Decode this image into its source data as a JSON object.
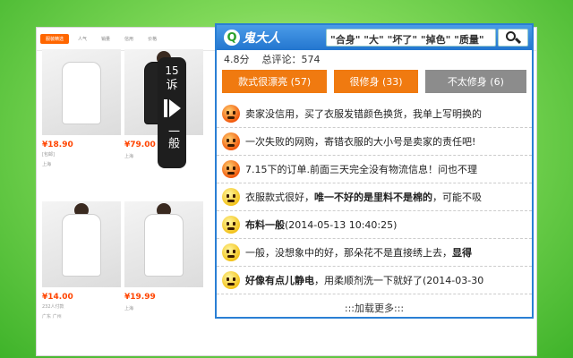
{
  "shop": {
    "nav": [
      "服装精选",
      "人气",
      "销量",
      "信用",
      "价格"
    ],
    "cards": [
      {
        "price": "¥18.90",
        "meta": "[包邮]",
        "loc": "上海"
      },
      {
        "price": "¥79.00",
        "meta": "",
        "loc": "上海"
      },
      {
        "price": "¥14.00",
        "meta": "232人付款",
        "loc": "广东 广州"
      },
      {
        "price": "¥19.99",
        "meta": "",
        "loc": "上海"
      }
    ]
  },
  "side_tab": {
    "count": "15",
    "label_top": "诉",
    "label_bottom": "一般"
  },
  "popup": {
    "logo_letter": "Q",
    "logo_text": "鬼大人",
    "search_value": "\"合身\" \"大\" \"坏了\" \"掉色\" \"质量\"",
    "score": "4.8分",
    "total_reviews": "总评论：574",
    "tags": [
      {
        "label": "款式很漂亮 (57)",
        "color": "#f07a10"
      },
      {
        "label": "很修身 (33)",
        "color": "#f07a10"
      },
      {
        "label": "不太修身 (6)",
        "color": "#8c8c8c"
      }
    ],
    "reviews": [
      {
        "mood": "angry",
        "text": "卖家没信用，买了衣服发错颜色换货，我单上写明换的"
      },
      {
        "mood": "angry",
        "text": "一次失败的网购，寄错衣服的大小号是卖家的责任吧!"
      },
      {
        "mood": "angry",
        "text": "7.15下的订单.前面三天完全没有物流信息！问也不理"
      },
      {
        "mood": "neutral",
        "text_pre": "衣服款式很好，",
        "text_bold": "唯一不好的是里料不是棉的",
        "text_post": "，可能不吸"
      },
      {
        "mood": "neutral",
        "text_bold": "布料一般",
        "text_post": "(2014-05-13 10:40:25)"
      },
      {
        "mood": "neutral",
        "text_pre": "一般，没想象中的好，那朵花不是直接绣上去，",
        "text_bold": "显得"
      },
      {
        "mood": "neutral",
        "text_bold": "好像有点儿静电",
        "text_post": "，用柔顺剂洗一下就好了(2014-03-30"
      }
    ],
    "load_more": ":::加载更多:::"
  },
  "icons": {
    "search": "search-icon",
    "angry_face": "angry-face-icon",
    "neutral_face": "neutral-face-icon",
    "play_arrow": "play-arrow-icon"
  }
}
